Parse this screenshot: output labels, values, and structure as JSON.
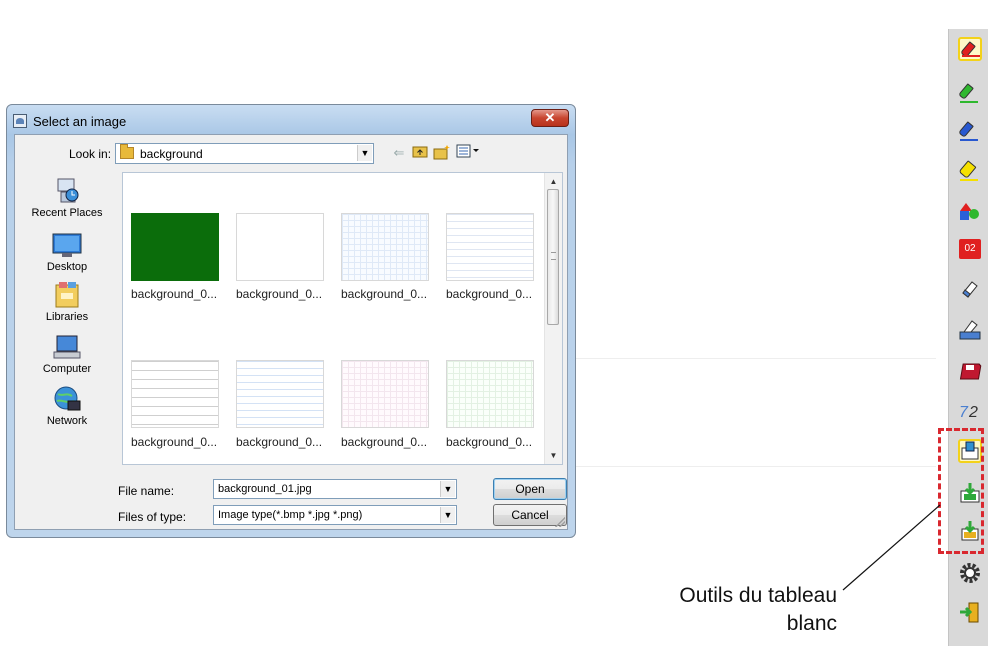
{
  "dialog": {
    "title": "Select an image",
    "look_in_label": "Look in:",
    "look_in_value": "background",
    "places": [
      "Recent Places",
      "Desktop",
      "Libraries",
      "Computer",
      "Network"
    ],
    "files": [
      {
        "name": "background_0...",
        "style": "green"
      },
      {
        "name": "background_0...",
        "style": "white"
      },
      {
        "name": "background_0...",
        "style": "grid"
      },
      {
        "name": "background_0...",
        "style": "ruled"
      },
      {
        "name": "background_0...",
        "style": "wide-ruled"
      },
      {
        "name": "background_0...",
        "style": "blue-ruled"
      },
      {
        "name": "background_0...",
        "style": "pink-grid"
      },
      {
        "name": "background_0...",
        "style": "green-grid"
      }
    ],
    "file_name_label": "File name:",
    "file_name_value": "background_01.jpg",
    "file_type_label": "Files of type:",
    "file_type_value": "Image type(*.bmp *.jpg *.png)",
    "open_label": "Open",
    "cancel_label": "Cancel"
  },
  "toolbar": {
    "tools": [
      {
        "name": "red-pen-icon",
        "color": "#e02020"
      },
      {
        "name": "green-pen-icon",
        "color": "#2fb82f"
      },
      {
        "name": "blue-pen-icon",
        "color": "#2858d0"
      },
      {
        "name": "highlighter-icon",
        "color": "#f5e000"
      },
      {
        "name": "shapes-icon",
        "color": "#2a60d8"
      },
      {
        "name": "line-width-icon",
        "color": "#e02020",
        "text": "02"
      },
      {
        "name": "eraser-icon",
        "color": "#4a7fd0"
      },
      {
        "name": "clear-eraser-icon",
        "color": "#4a7fd0"
      },
      {
        "name": "save-icon",
        "color": "#c01830"
      },
      {
        "name": "page-number-icon",
        "color": "#4a7fd0"
      },
      {
        "name": "background-image-icon",
        "color": "#3090d0"
      },
      {
        "name": "import-image-icon",
        "color": "#2fa83a"
      },
      {
        "name": "export-image-icon",
        "color": "#e8b020"
      },
      {
        "name": "settings-icon",
        "color": "#444444"
      },
      {
        "name": "exit-icon",
        "color": "#2fa83a"
      }
    ]
  },
  "callout": {
    "line1": "Outils du tableau",
    "line2": "blanc"
  },
  "colors": {
    "dashed_box": "#d9282f",
    "selected_tool": "#f3d21a"
  }
}
